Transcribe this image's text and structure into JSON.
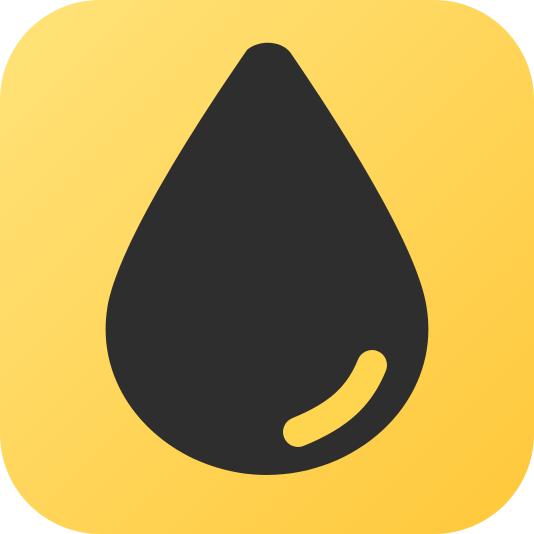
{
  "icon": {
    "name": "oil-drop-icon",
    "background_gradient": [
      "#FFE37A",
      "#FFC83A"
    ],
    "drop_color": "#2E2E2E",
    "highlight_color": "#FFD54F"
  }
}
